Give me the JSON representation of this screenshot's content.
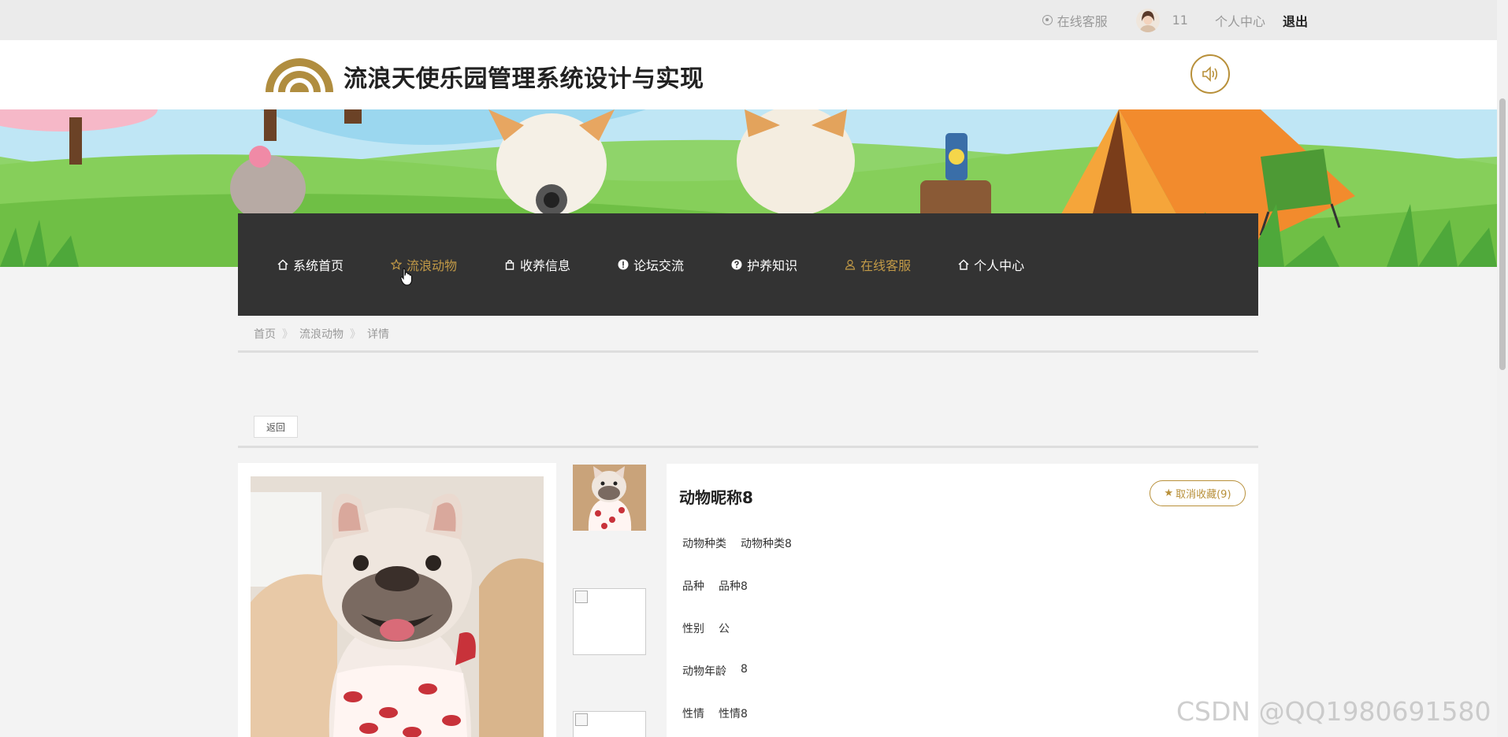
{
  "topbar": {
    "online_service": "在线客服",
    "username": "11",
    "user_center": "个人中心",
    "logout": "退出"
  },
  "header": {
    "site_title": "流浪天使乐园管理系统设计与实现",
    "brand_color": "#b8903a"
  },
  "nav": {
    "items": [
      {
        "label": "系统首页",
        "icon": "home-icon"
      },
      {
        "label": "流浪动物",
        "icon": "star-icon",
        "active": true
      },
      {
        "label": "收养信息",
        "icon": "bag-icon"
      },
      {
        "label": "论坛交流",
        "icon": "alert-icon"
      },
      {
        "label": "护养知识",
        "icon": "question-icon"
      },
      {
        "label": "在线客服",
        "icon": "user-icon",
        "active": true
      },
      {
        "label": "个人中心",
        "icon": "home-icon"
      }
    ]
  },
  "breadcrumb": {
    "home": "首页",
    "section": "流浪动物",
    "current": "详情"
  },
  "back_label": "返回",
  "detail": {
    "title": "动物昵称8",
    "favorite_label": "取消收藏(9)",
    "fields": [
      {
        "label": "动物种类",
        "value": "动物种类8"
      },
      {
        "label": "品种",
        "value": "品种8"
      },
      {
        "label": "性别",
        "value": "公"
      },
      {
        "label": "动物年龄",
        "value": "8"
      },
      {
        "label": "性情",
        "value": "性情8"
      }
    ]
  },
  "watermark": "CSDN @QQ1980691580"
}
